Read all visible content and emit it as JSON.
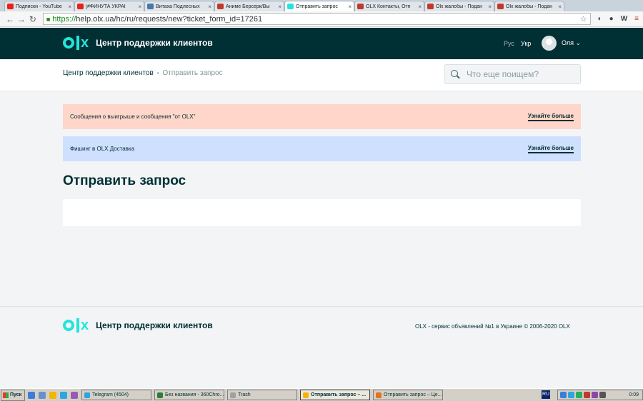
{
  "browser": {
    "tabs": [
      {
        "label": "Подписки - YouTube",
        "color": "#e62117"
      },
      {
        "label": "[#ФИНУТА УКРАЇ",
        "color": "#e62117"
      },
      {
        "label": "Витаха Подлесных",
        "color": "#4a76a8"
      },
      {
        "label": "Аниме Берсерк/Вы",
        "color": "#c0392b"
      },
      {
        "label": "Отправить запрос",
        "color": "#23e5db"
      },
      {
        "label": "OLX Контакты, Отп",
        "color": "#c0392b"
      },
      {
        "label": "Olx жалобы - Подан",
        "color": "#c0392b"
      },
      {
        "label": "Olx жалобы - Подан",
        "color": "#c0392b"
      }
    ],
    "active_tab_index": 4,
    "url_scheme": "https://",
    "url_rest": "help.olx.ua/hc/ru/requests/new?ticket_form_id=17261"
  },
  "header": {
    "logo_text": "Центр поддержки клиентов",
    "lang_ru": "Рус",
    "lang_uk": "Укр",
    "username": "Оля"
  },
  "breadcrumb": {
    "home": "Центр поддержки клиентов",
    "current": "Отправить запрос"
  },
  "search": {
    "placeholder": "Что еще поищем?"
  },
  "notices": [
    {
      "text": "Сообщения о выигрыше и сообщения \"от OLX\"",
      "link": "Узнайте больше",
      "color": "#ffd6c9"
    },
    {
      "text": "Фишинг в OLX Доставка",
      "link": "Узнайте больше",
      "color": "#cfe0ff"
    }
  ],
  "main": {
    "title": "Отправить запрос"
  },
  "footer": {
    "logo_text": "Центр поддержки клиентов",
    "copyright": "OLX - сервис объявлений №1 в Украине © 2006-2020 OLX"
  },
  "taskbar": {
    "start": "Пуск",
    "tasks": [
      {
        "label": "Telegram (4504)",
        "color": "#2ca5e0"
      },
      {
        "label": "Без названия - 360Chro...",
        "color": "#2e7d32"
      },
      {
        "label": "Trash",
        "color": "#a0a0a0"
      },
      {
        "label": "Отправить запрос – ...",
        "color": "#f4b400"
      },
      {
        "label": "Отправить запрос – Це...",
        "color": "#e8711a"
      }
    ],
    "active_task_index": 3,
    "lang": "RU",
    "clock": "0:09"
  }
}
